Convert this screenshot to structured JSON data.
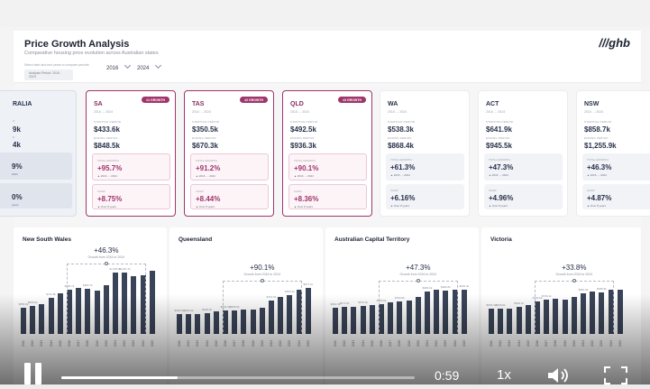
{
  "dashboard": {
    "title": "Price Growth Analysis",
    "subtitle": "Comparative housing price evolution across Australian states",
    "hint": "Select start and end years to compare periods",
    "period_label": "Analysis Period: 2016 - 2024",
    "start_year": "2016",
    "end_year": "2024",
    "logo": "///ghb"
  },
  "labels": {
    "starting": "STARTING PERIOD",
    "ending": "ENDING PERIOD",
    "total": "TOTAL GROWTH",
    "cagr": "CAGR"
  },
  "cards": [
    {
      "name": "RALIA",
      "range": "",
      "badge": "",
      "start": "9k",
      "end": "4k",
      "growth": "9%",
      "growth_sub": "2024",
      "cagr": "0%",
      "cagr_sub": "years"
    },
    {
      "name": "SA",
      "range": "2016 → 2024",
      "badge": "#1 GROWTH",
      "start": "$433.6k",
      "end": "$848.5k",
      "growth": "+95.7%",
      "growth_sub": "▲ 2016 → 2024",
      "cagr": "+8.75%",
      "cagr_sub": "▲ Over 8 years"
    },
    {
      "name": "TAS",
      "range": "2016 → 2024",
      "badge": "#2 GROWTH",
      "start": "$350.5k",
      "end": "$670.3k",
      "growth": "+91.2%",
      "growth_sub": "▲ 2016 → 2024",
      "cagr": "+8.44%",
      "cagr_sub": "▲ Over 8 years"
    },
    {
      "name": "QLD",
      "range": "2016 → 2024",
      "badge": "#3 GROWTH",
      "start": "$492.5k",
      "end": "$936.3k",
      "growth": "+90.1%",
      "growth_sub": "▲ 2016 → 2024",
      "cagr": "+8.36%",
      "cagr_sub": "▲ Over 8 years"
    },
    {
      "name": "WA",
      "range": "2016 → 2024",
      "badge": "",
      "start": "$538.3k",
      "end": "$868.4k",
      "growth": "+61.3%",
      "growth_sub": "▲ 2016 → 2024",
      "cagr": "+6.16%",
      "cagr_sub": "▲ Over 8 years"
    },
    {
      "name": "ACT",
      "range": "2016 → 2024",
      "badge": "",
      "start": "$641.9k",
      "end": "$945.5k",
      "growth": "+47.3%",
      "growth_sub": "▲ 2016 → 2024",
      "cagr": "+4.96%",
      "cagr_sub": "▲ Over 8 years"
    },
    {
      "name": "NSW",
      "range": "2016 → 2024",
      "badge": "",
      "start": "$858.7k",
      "end": "$1,255.9k",
      "growth": "+46.3%",
      "growth_sub": "▲ 2016 → 2024",
      "cagr": "+4.87%",
      "cagr_sub": "▲ Over 8 years"
    }
  ],
  "chart_data": [
    {
      "type": "bar",
      "title": "New South Wales",
      "annotation": "+46.3%",
      "annotation_sub": "Growth from 2016 to 2024",
      "categories": [
        "2011",
        "2012",
        "2013",
        "2014",
        "2015",
        "2016",
        "2017",
        "2018",
        "2019",
        "2020",
        "2021",
        "2022",
        "2023",
        "2024",
        "2025"
      ],
      "values": [
        555.8,
        589.0,
        641.0,
        769.0,
        858.7,
        937.0,
        983.0,
        958.0,
        930.0,
        1029.0,
        1306.0,
        1301.0,
        1232.0,
        1256.0,
        1340.0
      ],
      "value_labels": [
        "$555.8k",
        "$589.0k",
        "",
        "$743.8k",
        "",
        "$906.7k",
        "",
        "$933.7k",
        "",
        "",
        "$1,306.7k",
        "$1,301.7k",
        "",
        "",
        ""
      ],
      "ylim": [
        0,
        1500
      ]
    },
    {
      "type": "bar",
      "title": "Queensland",
      "annotation": "+90.1%",
      "annotation_sub": "Growth from 2016 to 2024",
      "categories": [
        "2011",
        "2012",
        "2013",
        "2014",
        "2015",
        "2016",
        "2017",
        "2018",
        "2019",
        "2020",
        "2021",
        "2022",
        "2023",
        "2024",
        "2025"
      ],
      "values": [
        425.0,
        430.4,
        420.0,
        448.0,
        473.0,
        492.5,
        505.0,
        516.0,
        520.0,
        560.0,
        714.0,
        780.0,
        830.0,
        936.3,
        977.0
      ],
      "value_labels": [
        "$425.0k",
        "$430.4k",
        "",
        "$448.0k",
        "",
        "$502.5k",
        "$505.6k",
        "",
        "",
        "",
        "$714.5k",
        "",
        "$830.2k",
        "",
        "$977.1k"
      ],
      "ylim": [
        0,
        1500
      ]
    },
    {
      "type": "bar",
      "title": "Australian Capital Territory",
      "annotation": "+47.3%",
      "annotation_sub": "Growth from 2016 to 2024",
      "categories": [
        "2011",
        "2012",
        "2013",
        "2014",
        "2015",
        "2016",
        "2017",
        "2018",
        "2019",
        "2020",
        "2021",
        "2022",
        "2023",
        "2024",
        "2025"
      ],
      "values": [
        561.0,
        572.0,
        575.0,
        598.0,
        621.0,
        641.9,
        675.0,
        690.0,
        703.0,
        781.0,
        909.0,
        940.0,
        918.0,
        945.5,
        949.0
      ],
      "value_labels": [
        "$561.5k",
        "$572.0k",
        "",
        "$575.3k",
        "",
        "$625.8k",
        "",
        "$703.6k",
        "",
        "",
        "$909.0k",
        "",
        "$906.8k",
        "",
        "$949.4k"
      ],
      "ylim": [
        0,
        1500
      ]
    },
    {
      "type": "bar",
      "title": "Victoria",
      "annotation": "+33.8%",
      "annotation_sub": "Growth from 2016 to 2024",
      "categories": [
        "2011",
        "2012",
        "2013",
        "2014",
        "2015",
        "2016",
        "2017",
        "2018",
        "2019",
        "2020",
        "2021",
        "2022",
        "2023",
        "2024",
        "2025"
      ],
      "values": [
        533.0,
        530.0,
        545.0,
        570.0,
        610.0,
        697.0,
        740.0,
        746.0,
        740.0,
        790.0,
        861.0,
        906.0,
        890.0,
        935.0,
        936.0
      ],
      "value_labels": [
        "$533.4k",
        "$530.5k",
        "",
        "$548.7k",
        "",
        "$740.5k",
        "$746.1k",
        "",
        "",
        "",
        "$861.9k",
        "",
        "$935.9k",
        "",
        ""
      ],
      "ylim": [
        0,
        1500
      ]
    }
  ],
  "player": {
    "time": "0:59",
    "speed": "1x",
    "progress": 0.33
  }
}
